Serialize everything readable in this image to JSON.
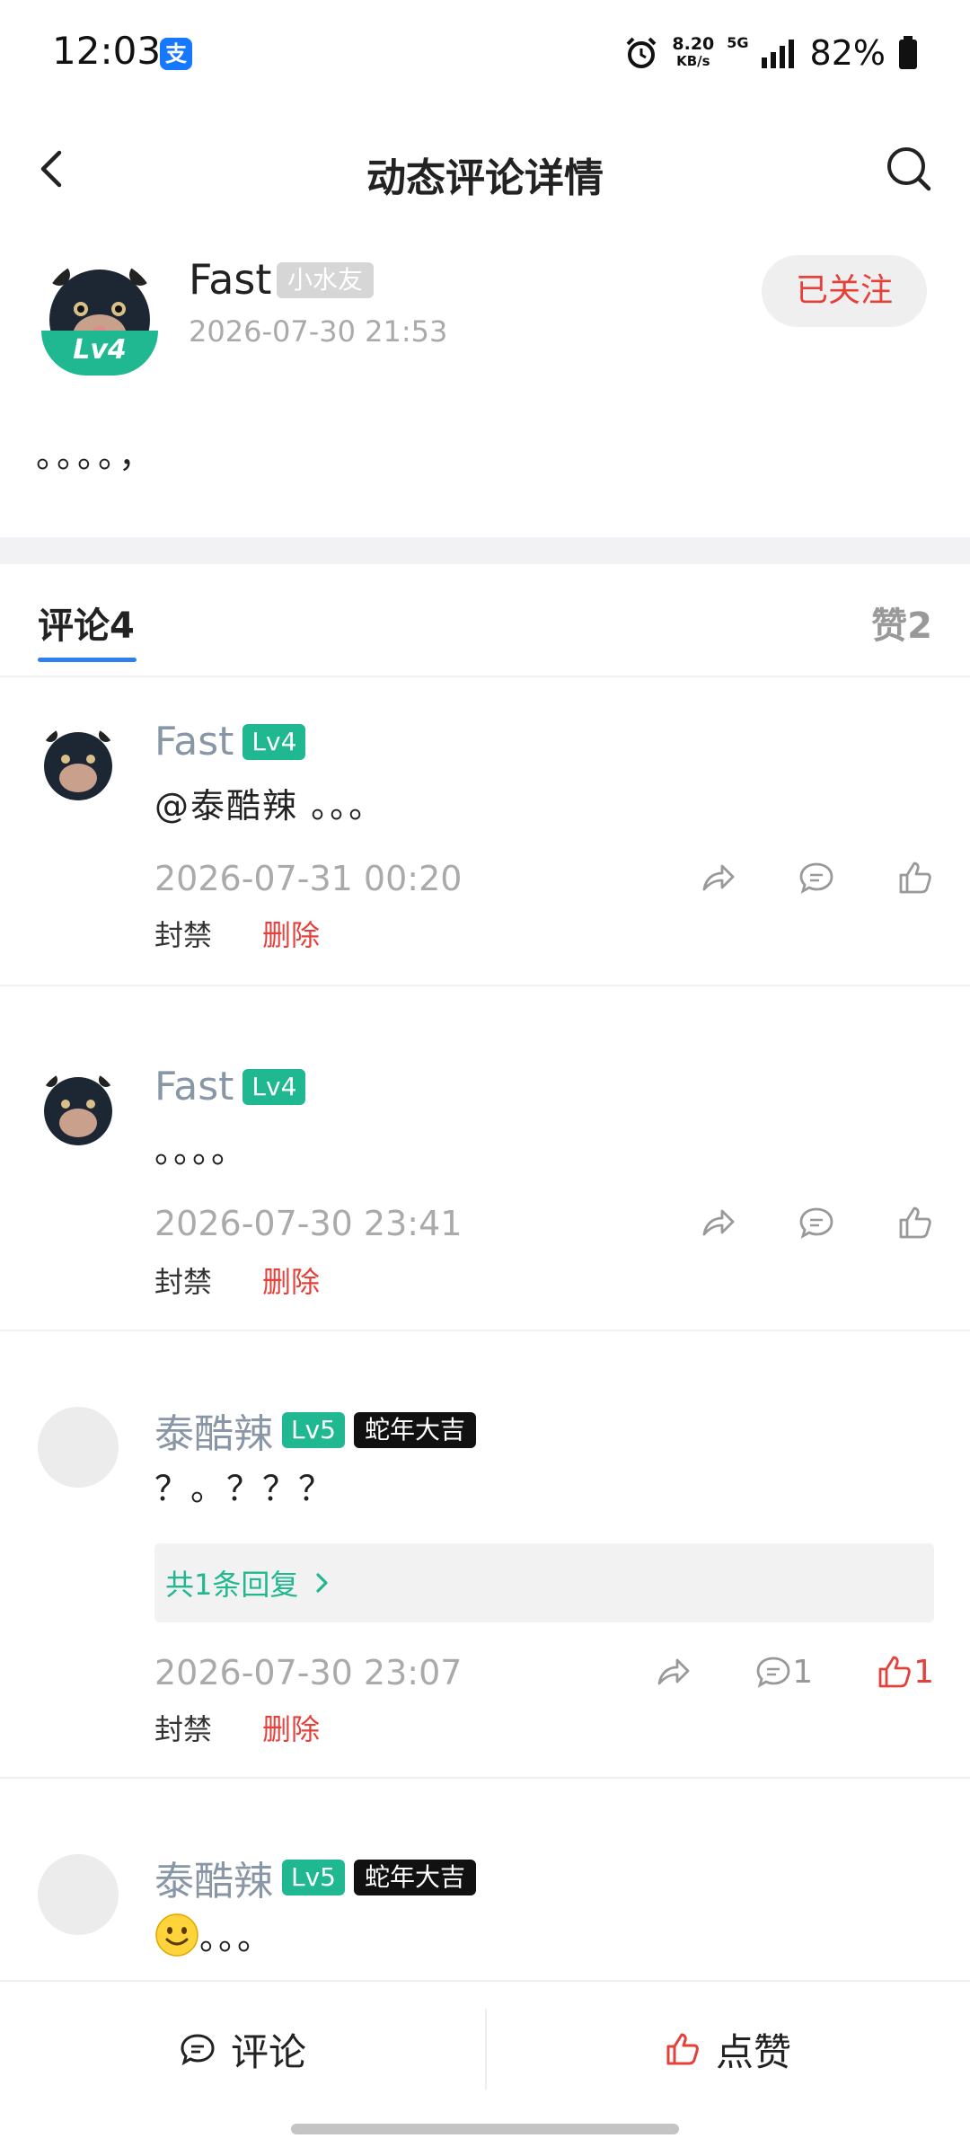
{
  "status_bar": {
    "time": "12:03",
    "app_icon": "支",
    "net_speed": "8.20",
    "net_unit": "KB/s",
    "network": "5G",
    "battery": "82%"
  },
  "header": {
    "title": "动态评论详情"
  },
  "post": {
    "author": "Fast",
    "author_badge": "小水友",
    "level": "Lv4",
    "time": "2026-07-30 21:53",
    "follow_label": "已关注",
    "content": "。。。。，"
  },
  "tabs": {
    "comments_label": "评论4",
    "likes_label": "赞2"
  },
  "comments": [
    {
      "name": "Fast",
      "level": "Lv4",
      "text": "@泰酷辣 。。。",
      "time": "2026-07-31 00:20",
      "ban_label": "封禁",
      "delete_label": "删除"
    },
    {
      "name": "Fast",
      "level": "Lv4",
      "text": "。。。。",
      "time": "2026-07-30 23:41",
      "ban_label": "封禁",
      "delete_label": "删除"
    },
    {
      "name": "泰酷辣",
      "level": "Lv5",
      "title_badge": "蛇年大吉",
      "text": "？。？？？",
      "reply_summary": "共1条回复",
      "time": "2026-07-30 23:07",
      "comment_count": "1",
      "like_count": "1",
      "ban_label": "封禁",
      "delete_label": "删除"
    },
    {
      "name": "泰酷辣",
      "level": "Lv5",
      "title_badge": "蛇年大吉",
      "text": "。。。"
    }
  ],
  "bottom_bar": {
    "comment_label": "评论",
    "like_label": "点赞"
  },
  "colors": {
    "accent_green": "#1fb890",
    "danger_red": "#e5403a",
    "tab_blue": "#2f80ed"
  }
}
